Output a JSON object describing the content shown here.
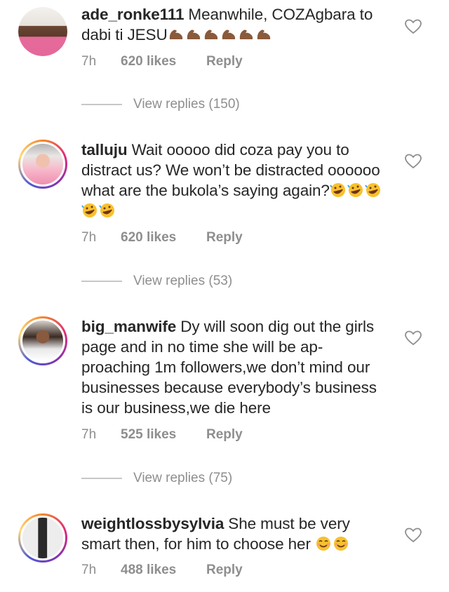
{
  "comments": [
    {
      "username": "ade_ronke111",
      "text": "Meanwhile, COZAgbara to dabi ti JESU",
      "emoji": "muscle x6",
      "time": "7h",
      "likes": "620 likes",
      "reply_label": "Reply",
      "view_replies": "View replies (150)"
    },
    {
      "username": "talluju",
      "text": "Wait ooooo did coza pay you to distract us? We won’t be distracted oooooo what are the bukola’s saying again?",
      "emoji": "rofl x5",
      "time": "7h",
      "likes": "620 likes",
      "reply_label": "Reply",
      "view_replies": "View replies (53)"
    },
    {
      "username": "big_manwife",
      "text": "Dy will soon dig out the girls page and in no time she will be ap-proaching 1m followers,we don’t mind our businesses because everybody’s business is our business,we die here",
      "time": "7h",
      "likes": "525 likes",
      "reply_label": "Reply",
      "view_replies": "View replies (75)"
    },
    {
      "username": "weightlossbysylvia",
      "text": "She must be very smart then, for him to choose her",
      "emoji": "smile x2",
      "time": "7h",
      "likes": "488 likes",
      "reply_label": "Reply"
    }
  ],
  "colors": {
    "text": "#262626",
    "secondary": "#8e8e8e",
    "story_ring": [
      "#f58529",
      "#dd2a7b",
      "#8134af"
    ]
  }
}
